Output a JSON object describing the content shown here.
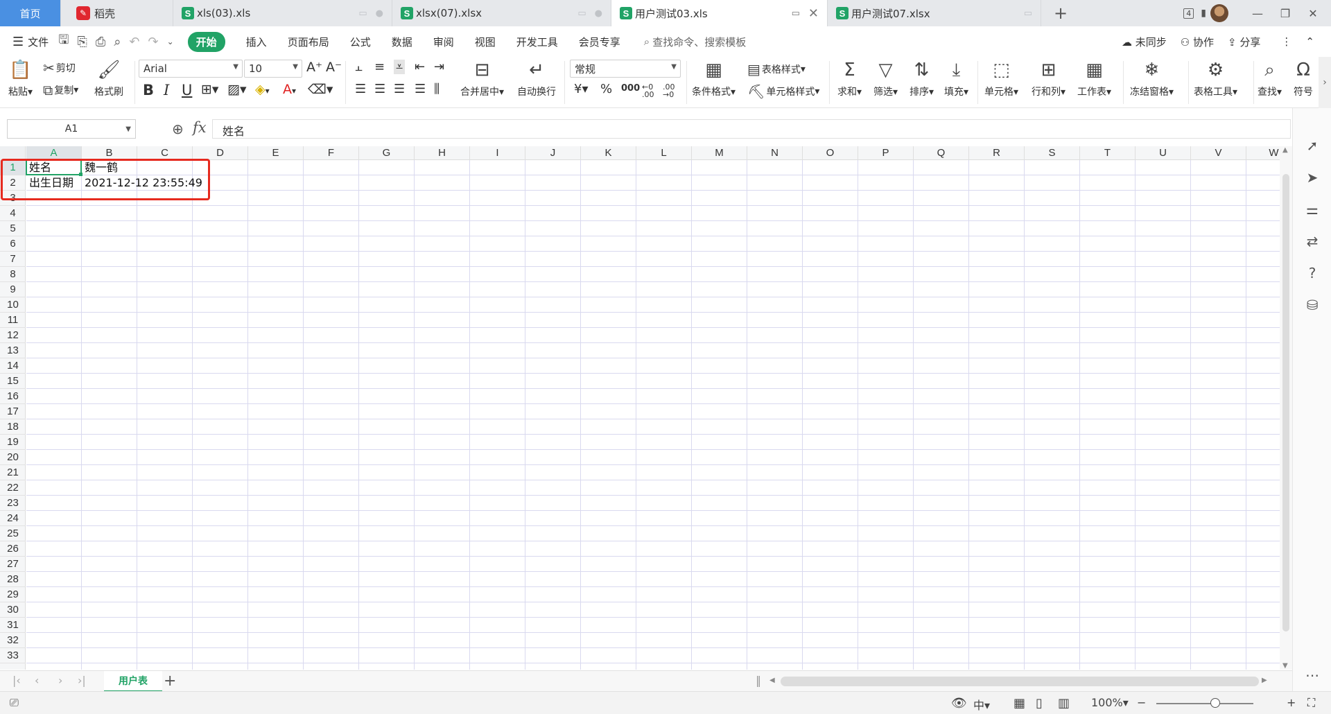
{
  "tabs": [
    {
      "label": "首页",
      "kind": "home"
    },
    {
      "label": "稻壳",
      "kind": "docer"
    },
    {
      "label": "xls(03).xls",
      "kind": "sheet"
    },
    {
      "label": "xlsx(07).xlsx",
      "kind": "sheet"
    },
    {
      "label": "用户测试03.xls",
      "kind": "sheet",
      "active": true
    },
    {
      "label": "用户测试07.xlsx",
      "kind": "sheet"
    }
  ],
  "window": {
    "badge": "4"
  },
  "menu": {
    "file": "文件",
    "start": "开始",
    "items": [
      "插入",
      "页面布局",
      "公式",
      "数据",
      "审阅",
      "视图",
      "开发工具",
      "会员专享"
    ],
    "search": "查找命令、搜索模板",
    "unsynced": "未同步",
    "collab": "协作",
    "share": "分享"
  },
  "ribbon": {
    "paste": "粘贴",
    "cut": "剪切",
    "copy": "复制",
    "format_painter": "格式刷",
    "font_name": "Arial",
    "font_size": "10",
    "merge_center": "合并居中",
    "wrap_text": "自动换行",
    "number_format": "常规",
    "cond_format": "条件格式",
    "table_style": "表格样式",
    "cell_style": "单元格样式",
    "sum": "求和",
    "filter": "筛选",
    "sort": "排序",
    "fill": "填充",
    "cell": "单元格",
    "row_col": "行和列",
    "worksheet": "工作表",
    "freeze": "冻结窗格",
    "table_tools": "表格工具",
    "find": "查找",
    "symbol": "符号",
    "currency": "¥",
    "percent": "%",
    "thousands": "000",
    "inc_decimal": "←0 .00",
    "dec_decimal": ".00 →0"
  },
  "formula_bar": {
    "name_box": "A1",
    "fx": "fx",
    "value": "姓名"
  },
  "grid": {
    "columns": [
      "A",
      "B",
      "C",
      "D",
      "E",
      "F",
      "G",
      "H",
      "I",
      "J",
      "K",
      "L",
      "M",
      "N",
      "O",
      "P",
      "Q",
      "R",
      "S",
      "T",
      "U",
      "V",
      "W"
    ],
    "rows": [
      "1",
      "2",
      "3",
      "4",
      "5",
      "6",
      "7",
      "8",
      "9",
      "10",
      "11",
      "12",
      "13",
      "14",
      "15",
      "16",
      "17",
      "18",
      "19",
      "20",
      "21",
      "22",
      "23",
      "24",
      "25",
      "26",
      "27",
      "28",
      "29",
      "30",
      "31",
      "32",
      "33"
    ],
    "cells": {
      "A1": "姓名",
      "B1": "魏一鹤",
      "A2": "出生日期",
      "B2": "2021-12-12 23:55:49"
    },
    "selected": "A1"
  },
  "sheets": {
    "active": "用户表"
  },
  "status": {
    "zoom": "100%"
  },
  "colors": {
    "accent": "#21a366",
    "highlight": "#e62a1f",
    "home_tab": "#4a90e2"
  }
}
